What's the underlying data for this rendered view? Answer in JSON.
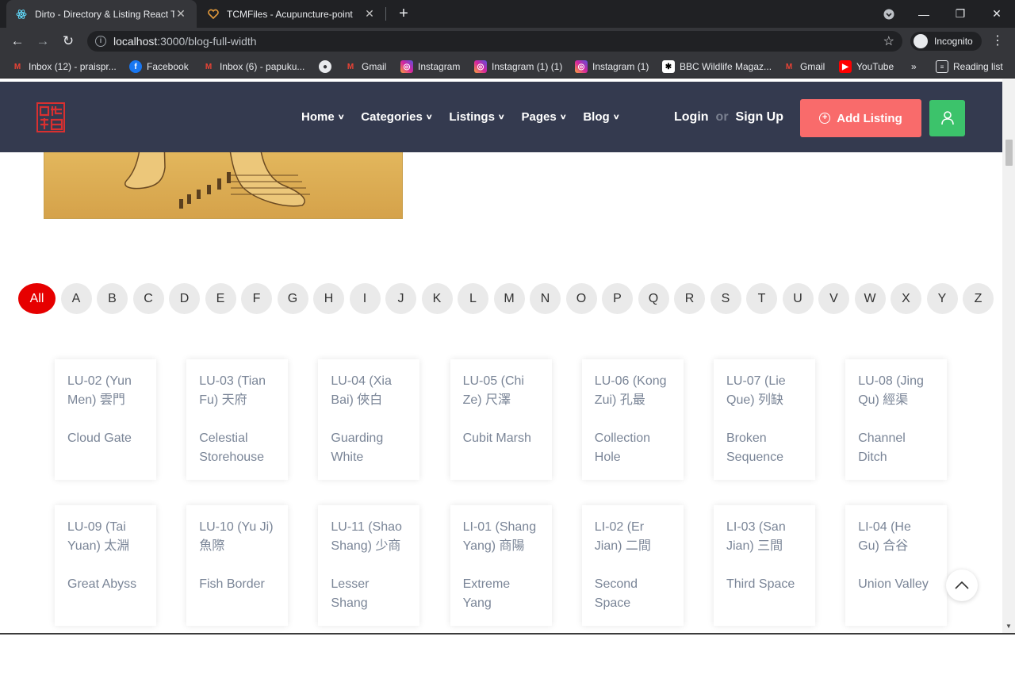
{
  "browser": {
    "tabs": [
      {
        "title": "Dirto - Directory & Listing React T",
        "active": true
      },
      {
        "title": "TCMFiles - Acupuncture-point",
        "active": false
      }
    ],
    "url_host": "localhost",
    "url_rest": ":3000/blog-full-width",
    "incognito_label": "Incognito",
    "bookmarks": [
      {
        "label": "Inbox (12) - praispr...",
        "icon": "gmail-icon"
      },
      {
        "label": "Facebook",
        "icon": "facebook-icon"
      },
      {
        "label": "Inbox (6) - papuku...",
        "icon": "gmail-icon"
      },
      {
        "label": "",
        "icon": "globe-icon"
      },
      {
        "label": "Gmail",
        "icon": "gmail-icon"
      },
      {
        "label": "Instagram",
        "icon": "instagram-icon"
      },
      {
        "label": "Instagram (1) (1)",
        "icon": "instagram-icon"
      },
      {
        "label": "Instagram (1)",
        "icon": "instagram-icon"
      },
      {
        "label": "BBC Wildlife Magaz...",
        "icon": "paw-icon"
      },
      {
        "label": "Gmail",
        "icon": "gmail-icon"
      },
      {
        "label": "YouTube",
        "icon": "youtube-icon"
      }
    ],
    "more_bookmarks": "»",
    "reading_list": "Reading list"
  },
  "site": {
    "nav": [
      {
        "label": "Home"
      },
      {
        "label": "Categories"
      },
      {
        "label": "Listings"
      },
      {
        "label": "Pages"
      },
      {
        "label": "Blog"
      }
    ],
    "login": "Login",
    "or": "or",
    "signup": "Sign Up",
    "add_listing": "Add Listing",
    "colors": {
      "nav_bg": "#343a4f",
      "add_listing": "#f96b6b",
      "user_btn": "#3cc36b",
      "active_letter": "#e60000"
    }
  },
  "alphabet": {
    "active": "All",
    "letters": [
      "All",
      "A",
      "B",
      "C",
      "D",
      "E",
      "F",
      "G",
      "H",
      "I",
      "J",
      "K",
      "L",
      "M",
      "N",
      "O",
      "P",
      "Q",
      "R",
      "S",
      "T",
      "U",
      "V",
      "W",
      "X",
      "Y",
      "Z"
    ]
  },
  "points": [
    {
      "code": "LU-02 (Yun Men) 雲門",
      "english": "Cloud Gate"
    },
    {
      "code": "LU-03 (Tian Fu) 天府",
      "english": "Celestial Storehouse"
    },
    {
      "code": "LU-04 (Xia Bai) 俠白",
      "english": "Guarding White"
    },
    {
      "code": "LU-05 (Chi Ze) 尺澤",
      "english": "Cubit Marsh"
    },
    {
      "code": "LU-06 (Kong Zui) 孔最",
      "english": "Collection Hole"
    },
    {
      "code": "LU-07 (Lie Que) 列缺",
      "english": "Broken Sequence"
    },
    {
      "code": "LU-08 (Jing Qu) 經渠",
      "english": "Channel Ditch"
    },
    {
      "code": "LU-09 (Tai Yuan) 太淵",
      "english": "Great Abyss"
    },
    {
      "code": "LU-10 (Yu Ji) 魚際",
      "english": "Fish Border"
    },
    {
      "code": "LU-11 (Shao Shang) 少商",
      "english": "Lesser Shang"
    },
    {
      "code": "LI-01 (Shang Yang) 商陽",
      "english": "Extreme Yang"
    },
    {
      "code": "LI-02 (Er Jian) 二間",
      "english": "Second Space"
    },
    {
      "code": "LI-03 (San Jian) 三間",
      "english": "Third Space"
    },
    {
      "code": "LI-04 (He Gu) 合谷",
      "english": "Union Valley"
    }
  ]
}
